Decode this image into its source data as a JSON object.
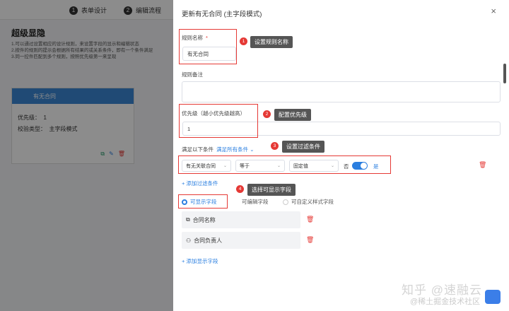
{
  "background": {
    "steps": [
      {
        "num": "1",
        "label": "表单设计"
      },
      {
        "num": "2",
        "label": "编辑流程"
      }
    ],
    "title": "超级显隐",
    "desc": [
      "1.可以通过设置相应的设计规则，来设置字段的显示和编辑状态",
      "2.按件的规则的提示会根据所有结果的或关系条件，即有一个条件满足",
      "3.同一控件匹配到多个规则，按照优先级第一来呈现"
    ],
    "card": {
      "name": "有无合同",
      "priority_label": "优先级：",
      "priority_value": "1",
      "mode_label": "校验类型：",
      "mode_value": "主字段模式"
    }
  },
  "drawer": {
    "title": "更新有无合同 (主字段模式)",
    "close": "×",
    "rule_name_label": "规则名称",
    "required_mark": "*",
    "rule_name_value": "有无合同",
    "remark_label": "规则备注",
    "priority_label": "优先级（越小优先级越高）",
    "priority_value": "1",
    "condition_prefix": "满足以下条件",
    "condition_mode": "满足所有条件",
    "condition_row": {
      "field": "有无关联合同",
      "op": "等于",
      "value_type": "固定值",
      "no": "否",
      "yes": "是"
    },
    "add_filter": "+ 添加过滤条件",
    "tabs": [
      "可显示字段",
      "可编辑字段",
      "可自定义样式字段"
    ],
    "fields": [
      "合同名称",
      "合同负责人"
    ],
    "add_display": "+ 添加显示字段"
  },
  "annotations": [
    {
      "num": "1",
      "text": "设置规则名称"
    },
    {
      "num": "2",
      "text": "配置优先级"
    },
    {
      "num": "3",
      "text": "设置过滤条件"
    },
    {
      "num": "4",
      "text": "选择可显示字段"
    }
  ],
  "watermark": {
    "line1": "知乎 @速融云",
    "line2": "@稀土掘金技术社区"
  },
  "colors": {
    "accent": "#2b7fe0",
    "annotation": "#e53935"
  }
}
